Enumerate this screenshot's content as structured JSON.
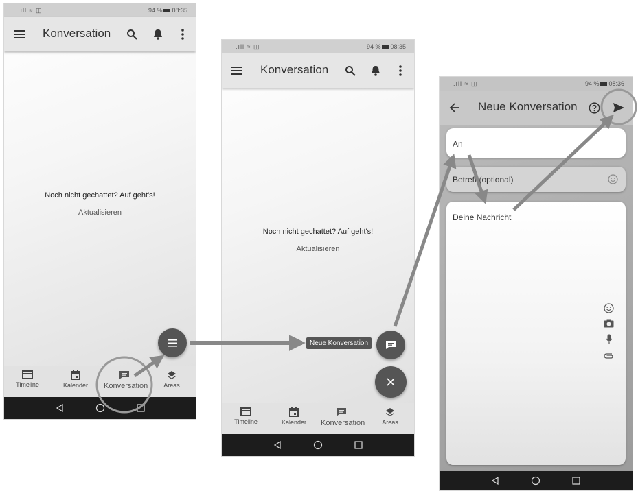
{
  "screen1": {
    "status_left": ".ıll ≈ ◫",
    "status_battery": "94 %",
    "status_time": "08:35",
    "title": "Konversation",
    "empty_text": "Noch nicht gechattet? Auf geht's!",
    "refresh_label": "Aktualisieren",
    "nav": [
      "Timeline",
      "Kalender",
      "Konversation",
      "Areas"
    ]
  },
  "screen2": {
    "status_left": ".ıll ≈ ◫",
    "status_battery": "94 %",
    "status_time": "08:35",
    "title": "Konversation",
    "empty_text": "Noch nicht gechattet? Auf geht's!",
    "refresh_label": "Aktualisieren",
    "fab_label": "Neue Konversation",
    "nav": [
      "Timeline",
      "Kalender",
      "Konversation",
      "Areas"
    ]
  },
  "screen3": {
    "status_left": ".ıll ≈ ◫",
    "status_battery": "94 %",
    "status_time": "08:36",
    "title": "Neue Konversation",
    "to_placeholder": "An",
    "subject_placeholder": "Betreff (optional)",
    "message_placeholder": "Deine Nachricht"
  },
  "icons": [
    "menu-icon",
    "search-icon",
    "bell-icon",
    "more-vert-icon",
    "timeline-icon",
    "calendar-icon",
    "chat-icon",
    "layers-icon",
    "back-icon",
    "home-icon",
    "recents-icon",
    "close-icon",
    "arrow-back-icon",
    "help-icon",
    "send-icon",
    "emoji-icon",
    "camera-icon",
    "mic-icon",
    "attach-icon"
  ],
  "colors": {
    "appbar": "#e6e6e6",
    "fab": "#555555",
    "sysnav": "#1c1c1c",
    "annotation": "#888888"
  }
}
